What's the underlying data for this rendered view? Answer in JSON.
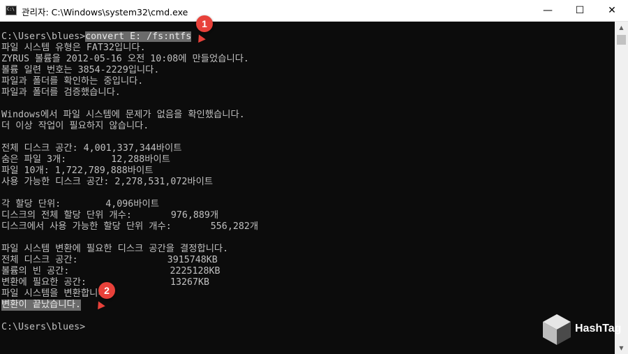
{
  "window": {
    "title": "관리자: C:\\Windows\\system32\\cmd.exe",
    "minimize_glyph": "—",
    "maximize_glyph": "☐",
    "close_glyph": "✕"
  },
  "console": {
    "lines": [
      "C:\\Users\\blues>convert E: /fs:ntfs",
      "파일 시스템 유형은 FAT32입니다.",
      "ZYRUS 볼륨을 2012-05-16 오전 10:08에 만들었습니다.",
      "볼륨 일련 번호는 3854-2229입니다.",
      "파일과 폴더를 확인하는 중입니다.",
      "파일과 폴더를 검증했습니다.",
      "",
      "Windows에서 파일 시스템에 문제가 없음을 확인했습니다.",
      "더 이상 작업이 필요하지 않습니다.",
      "",
      "전체 디스크 공간: 4,001,337,344바이트",
      "숨은 파일 3개:        12,288바이트",
      "파일 10개: 1,722,789,888바이트",
      "사용 가능한 디스크 공간: 2,278,531,072바이트",
      "",
      "각 할당 단위:        4,096바이트",
      "디스크의 전체 할당 단위 개수:       976,889개",
      "디스크에서 사용 가능한 할당 단위 개수:       556,282개",
      "",
      "파일 시스템 변환에 필요한 디스크 공간을 결정합니다.",
      "전체 디스크 공간:                3915748KB",
      "볼륨의 빈 공간:                  2225128KB",
      "변환에 필요한 공간:               13267KB",
      "파일 시스템을 변환합니다.",
      "변환이 끝났습니다.",
      "",
      "C:\\Users\\blues>"
    ]
  },
  "annotations": {
    "badge_1": "1",
    "badge_2": "2"
  },
  "watermark": {
    "text": "HashTag",
    "cube_text": "Hash Tag"
  },
  "colors": {
    "console_bg": "#0c0c0c",
    "console_text": "#c0c0c0",
    "highlight_bg": "#6b6b6b",
    "badge": "#e8413a"
  }
}
